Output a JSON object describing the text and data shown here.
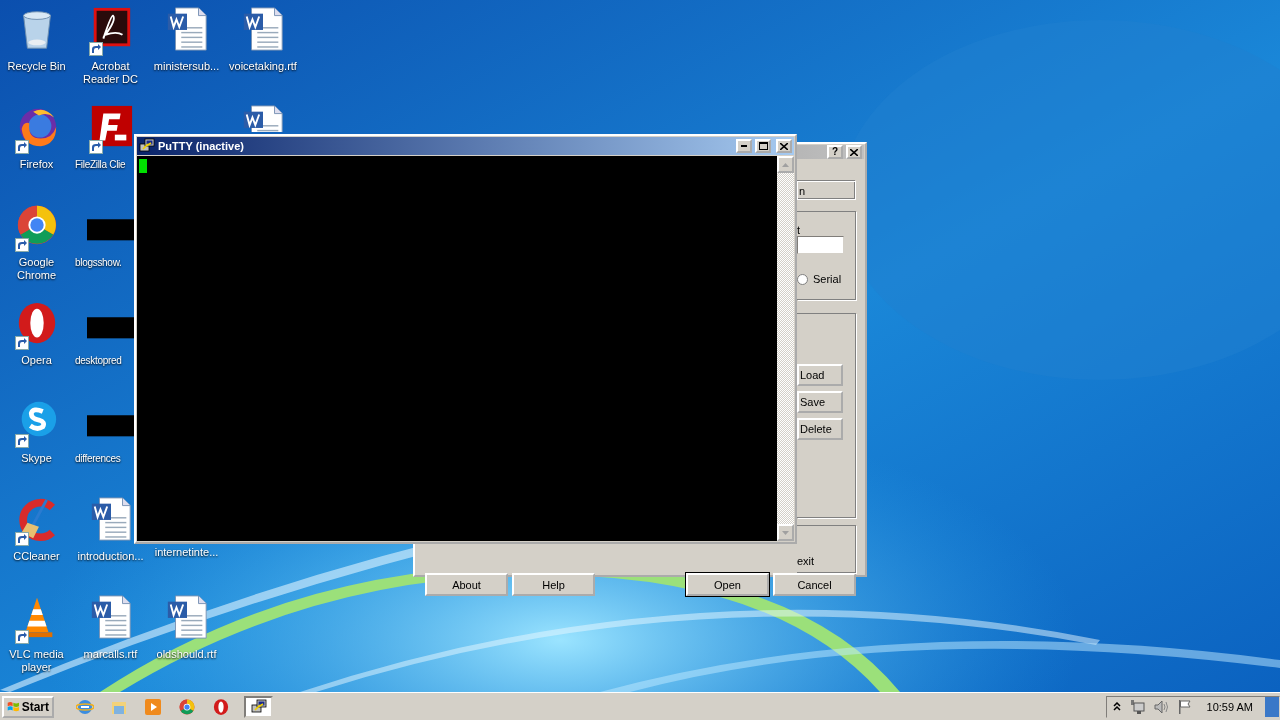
{
  "desktop": {
    "icons": [
      {
        "label": "Recycle Bin",
        "kind": "recycle-bin",
        "shortcut": false
      },
      {
        "label": "Acrobat Reader DC",
        "kind": "acrobat",
        "shortcut": true
      },
      {
        "label": "ministersub...",
        "kind": "word",
        "shortcut": false
      },
      {
        "label": "voicetaking.rtf",
        "kind": "word",
        "shortcut": false
      },
      {
        "label": "Firefox",
        "kind": "firefox",
        "shortcut": true
      },
      {
        "label": "FileZilla Clie",
        "kind": "filezilla",
        "shortcut": true
      },
      {
        "kind": "word"
      },
      {
        "label": "Google Chrome",
        "kind": "chrome",
        "shortcut": true
      },
      {
        "label": "blogsshow.",
        "kind": "redacted",
        "shortcut": false
      },
      {
        "label": "Opera",
        "kind": "opera",
        "shortcut": true
      },
      {
        "label": "desktopred",
        "kind": "redacted",
        "shortcut": false
      },
      {
        "label": "Skype",
        "kind": "skype",
        "shortcut": true
      },
      {
        "label": "differences",
        "kind": "redacted",
        "shortcut": false
      },
      {
        "label": "CCleaner",
        "kind": "ccleaner",
        "shortcut": true
      },
      {
        "label": "introduction...",
        "kind": "word",
        "shortcut": false
      },
      {
        "label": "internetinte...",
        "kind": "covered"
      },
      {
        "label": "VLC media player",
        "kind": "vlc",
        "shortcut": true
      },
      {
        "label": "marcalls.rtf",
        "kind": "word",
        "shortcut": false
      },
      {
        "label": "oldshould.rtf",
        "kind": "word",
        "shortcut": false
      }
    ]
  },
  "config_dialog": {
    "help_glyph": "?",
    "field_text": "n",
    "group_label": "t",
    "radio": {
      "label": "Serial",
      "selected": false
    },
    "session_buttons": [
      "Load",
      "Save",
      "Delete"
    ],
    "exit_label": "exit",
    "buttons": [
      {
        "label": "About",
        "default": false
      },
      {
        "label": "Help",
        "default": false
      },
      {
        "label": "Open",
        "default": true
      },
      {
        "label": "Cancel",
        "default": false
      }
    ]
  },
  "terminal_window": {
    "title": "PuTTY (inactive)"
  },
  "taskbar": {
    "start_label": "Start",
    "apps": [
      {
        "kind": "ie",
        "active": false
      },
      {
        "kind": "explorer",
        "active": false
      },
      {
        "kind": "media",
        "active": false
      },
      {
        "kind": "chrome",
        "active": false
      },
      {
        "kind": "opera",
        "active": false
      },
      {
        "kind": "putty",
        "active": true
      }
    ],
    "clock": "10:59 AM"
  }
}
